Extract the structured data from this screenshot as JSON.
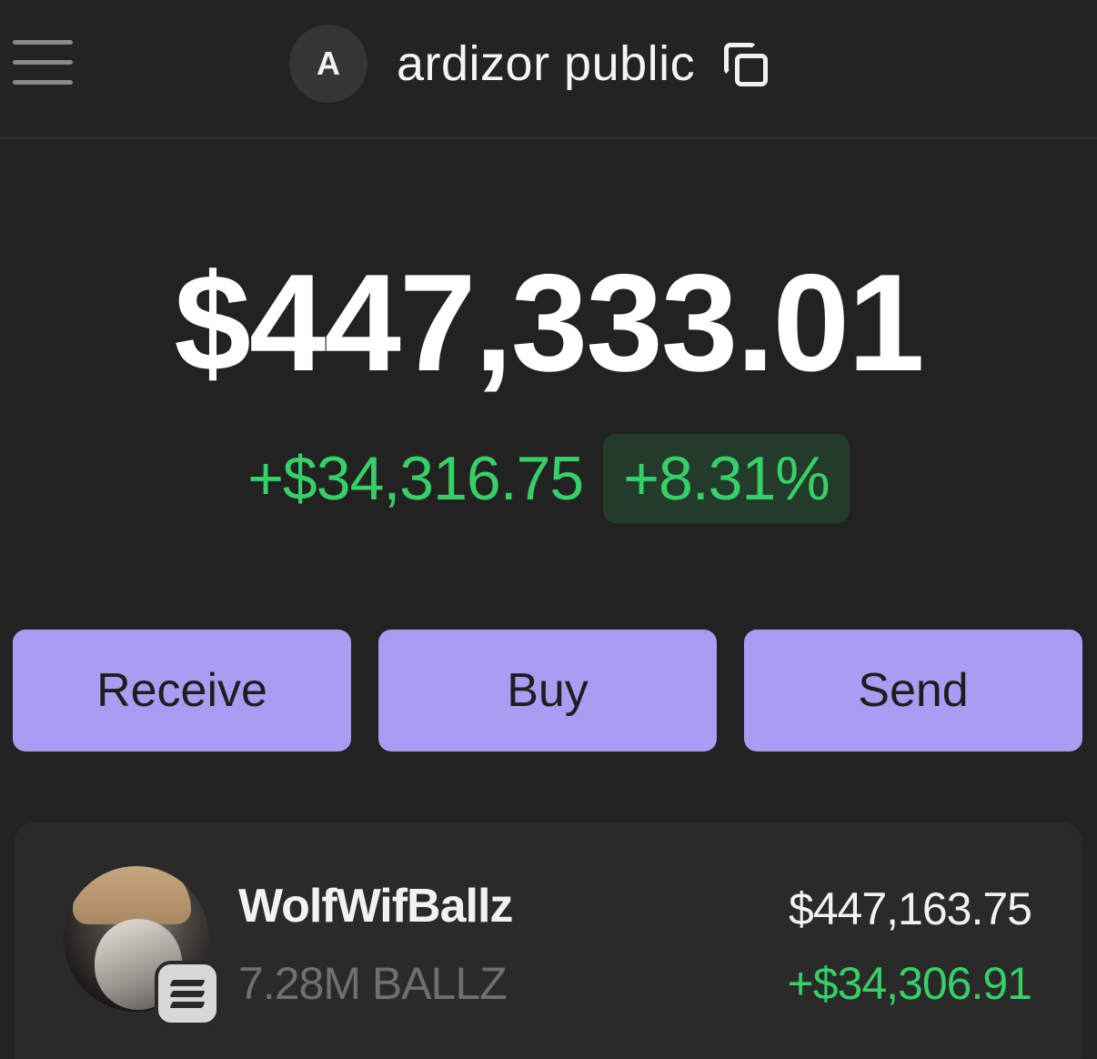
{
  "header": {
    "avatar_letter": "A",
    "account_name": "ardizor public",
    "icons": {
      "menu": "hamburger-menu-icon",
      "copy": "copy-icon"
    }
  },
  "portfolio": {
    "balance": "$447,333.01",
    "change_amount": "+$34,316.75",
    "change_percent": "+8.31%"
  },
  "actions": {
    "receive_label": "Receive",
    "buy_label": "Buy",
    "send_label": "Send"
  },
  "tokens": [
    {
      "name": "WolfWifBallz",
      "amount": "7.28M BALLZ",
      "value": "$447,163.75",
      "change": "+$34,306.91",
      "chain_icon": "solana-chain-icon"
    }
  ],
  "colors": {
    "background": "#222222",
    "accent_button": "#a99cf2",
    "positive": "#36cf68",
    "positive_badge_bg": "#233b2b",
    "card": "#2a2a2a"
  }
}
